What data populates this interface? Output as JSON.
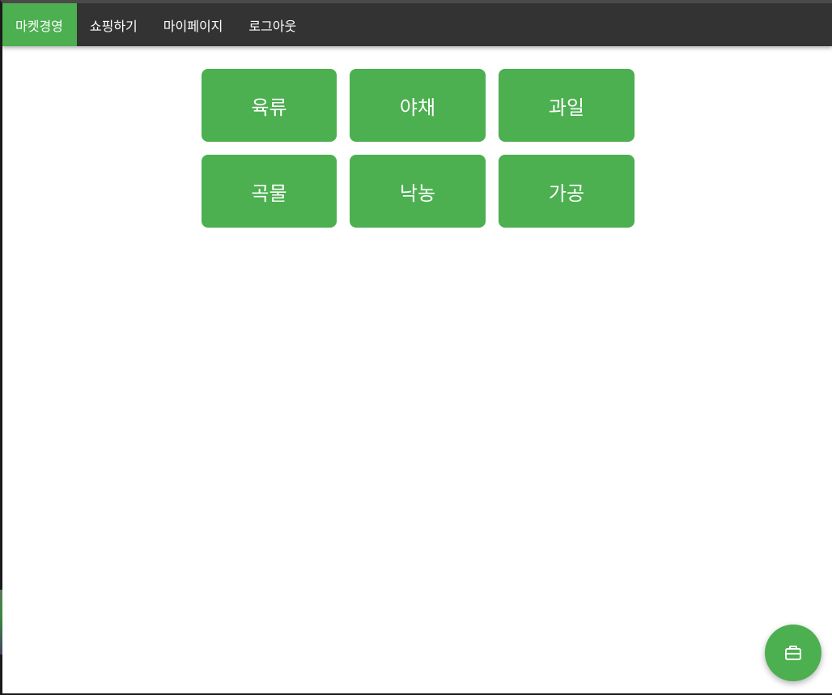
{
  "navbar": {
    "items": [
      {
        "label": "마켓경영",
        "active": true
      },
      {
        "label": "쇼핑하기",
        "active": false
      },
      {
        "label": "마이페이지",
        "active": false
      },
      {
        "label": "로그아웃",
        "active": false
      }
    ]
  },
  "categories": [
    {
      "label": "육류"
    },
    {
      "label": "야채"
    },
    {
      "label": "과일"
    },
    {
      "label": "곡물"
    },
    {
      "label": "낙농"
    },
    {
      "label": "가공"
    }
  ],
  "fab": {
    "icon": "briefcase-icon"
  },
  "colors": {
    "accent": "#4caf50",
    "navbar_bg": "#333333",
    "text_light": "#ffffff"
  }
}
